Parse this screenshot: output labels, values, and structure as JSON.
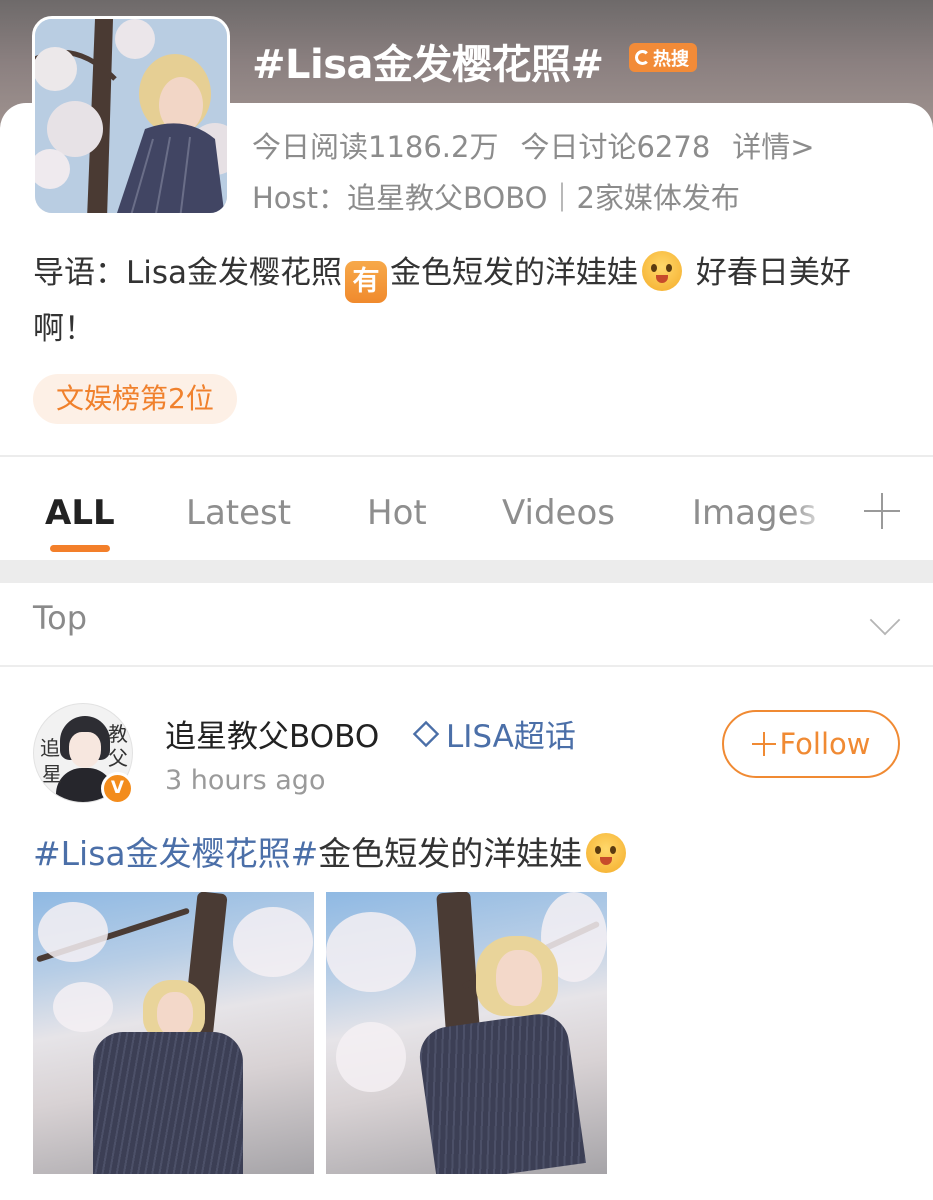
{
  "topic": {
    "title": "#Lisa金发樱花照#",
    "hot_badge": "热搜",
    "read_stat": "今日阅读1186.2万",
    "discuss_stat": "今日讨论6278",
    "details_link": "详情>",
    "host_line": "Host：追星教父BOBO｜2家媒体发布",
    "intro_prefix": "导语：Lisa金发樱花照",
    "intro_badge": "有",
    "intro_mid": "金色短发的洋娃娃",
    "intro_suffix": " 好春日美好啊！",
    "rank_tag": "文娱榜第2位"
  },
  "tabs": {
    "items": [
      "ALL",
      "Latest",
      "Hot",
      "Videos",
      "Images"
    ],
    "active_index": 0
  },
  "sort": {
    "label": "Top"
  },
  "post": {
    "avatar_glyphs": [
      "追",
      "星",
      "教",
      "父"
    ],
    "verified_badge": "V",
    "username": "追星教父BOBO",
    "super_topic": "LISA超话",
    "time": "3 hours ago",
    "follow_label": "Follow",
    "hashtag": "#Lisa金发樱花照#",
    "text": "金色短发的洋娃娃"
  },
  "colors": {
    "accent_orange": "#f37f2a",
    "link_blue": "#4b6fa8",
    "header_gray": "#8b8080"
  },
  "icons": [
    "flame-icon",
    "reaction-emoji-icon",
    "plus-icon",
    "chevron-down-icon",
    "diamond-icon",
    "verified-badge-icon"
  ]
}
